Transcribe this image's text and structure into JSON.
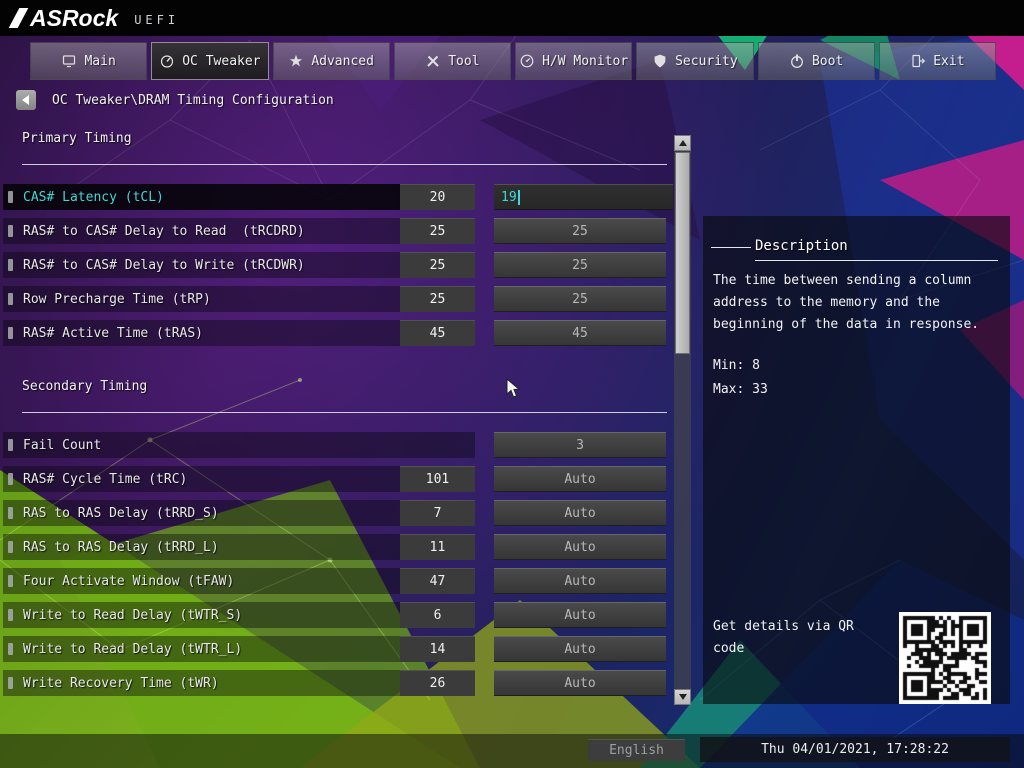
{
  "header": {
    "brand": "ASRock",
    "uefi": "UEFI"
  },
  "tabs": [
    {
      "label": "Main"
    },
    {
      "label": "OC Tweaker"
    },
    {
      "label": "Advanced"
    },
    {
      "label": "Tool"
    },
    {
      "label": "H/W Monitor"
    },
    {
      "label": "Security"
    },
    {
      "label": "Boot"
    },
    {
      "label": "Exit"
    }
  ],
  "breadcrumb": "OC Tweaker\\DRAM Timing Configuration",
  "sections": [
    {
      "title": "Primary Timing",
      "rows": [
        {
          "label": "CAS# Latency (tCL)",
          "current": "20",
          "value": "19"
        },
        {
          "label": "RAS# to CAS# Delay to Read  (tRCDRD)",
          "current": "25",
          "value": "25"
        },
        {
          "label": "RAS# to CAS# Delay to Write (tRCDWR)",
          "current": "25",
          "value": "25"
        },
        {
          "label": "Row Precharge Time (tRP)",
          "current": "25",
          "value": "25"
        },
        {
          "label": "RAS# Active Time (tRAS)",
          "current": "45",
          "value": "45"
        }
      ]
    },
    {
      "title": "Secondary Timing",
      "rows": [
        {
          "label": "Fail Count",
          "value": "3"
        },
        {
          "label": "RAS# Cycle Time (tRC)",
          "current": "101",
          "value": "Auto"
        },
        {
          "label": "RAS to RAS Delay (tRRD_S)",
          "current": "7",
          "value": "Auto"
        },
        {
          "label": "RAS to RAS Delay (tRRD_L)",
          "current": "11",
          "value": "Auto"
        },
        {
          "label": "Four Activate Window (tFAW)",
          "current": "47",
          "value": "Auto"
        },
        {
          "label": "Write to Read Delay (tWTR_S)",
          "current": "6",
          "value": "Auto"
        },
        {
          "label": "Write to Read Delay (tWTR_L)",
          "current": "14",
          "value": "Auto"
        },
        {
          "label": "Write Recovery Time (tWR)",
          "current": "26",
          "value": "Auto"
        }
      ]
    }
  ],
  "description": {
    "title": "Description",
    "lines": [
      "The time between sending a column",
      "address to the memory and the",
      "beginning of the data in response."
    ],
    "min": "Min: 8",
    "max": "Max: 33",
    "qr_caption_lines": [
      "Get details via QR",
      "code"
    ]
  },
  "footer": {
    "language": "English",
    "datetime": "Thu 04/01/2021, 17:28:22"
  },
  "colors": {
    "accent_cyan": "#3fd8d8",
    "box_gray": "#3b3b3b"
  }
}
